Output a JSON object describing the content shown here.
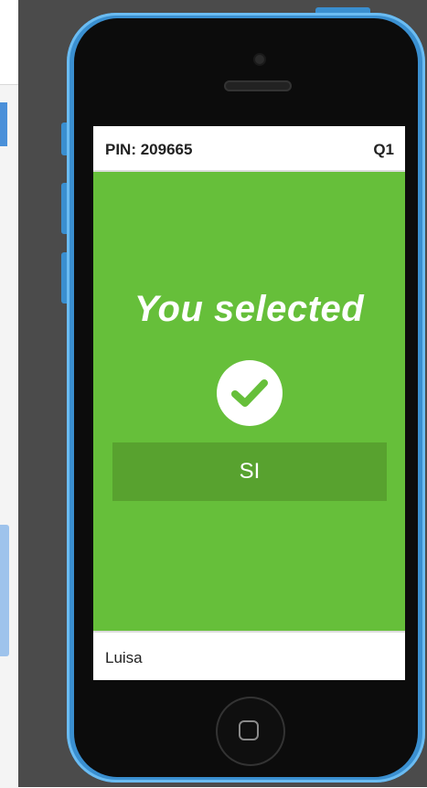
{
  "header": {
    "pin": "PIN: 209665",
    "question": "Q1"
  },
  "result": {
    "message": "You selected",
    "answer": "SI",
    "status_icon": "check-icon"
  },
  "footer": {
    "player_name": "Luisa"
  },
  "colors": {
    "screen_green": "#66bf3a",
    "answer_bg": "#58a22f",
    "phone_body": "#3a8fd0"
  }
}
